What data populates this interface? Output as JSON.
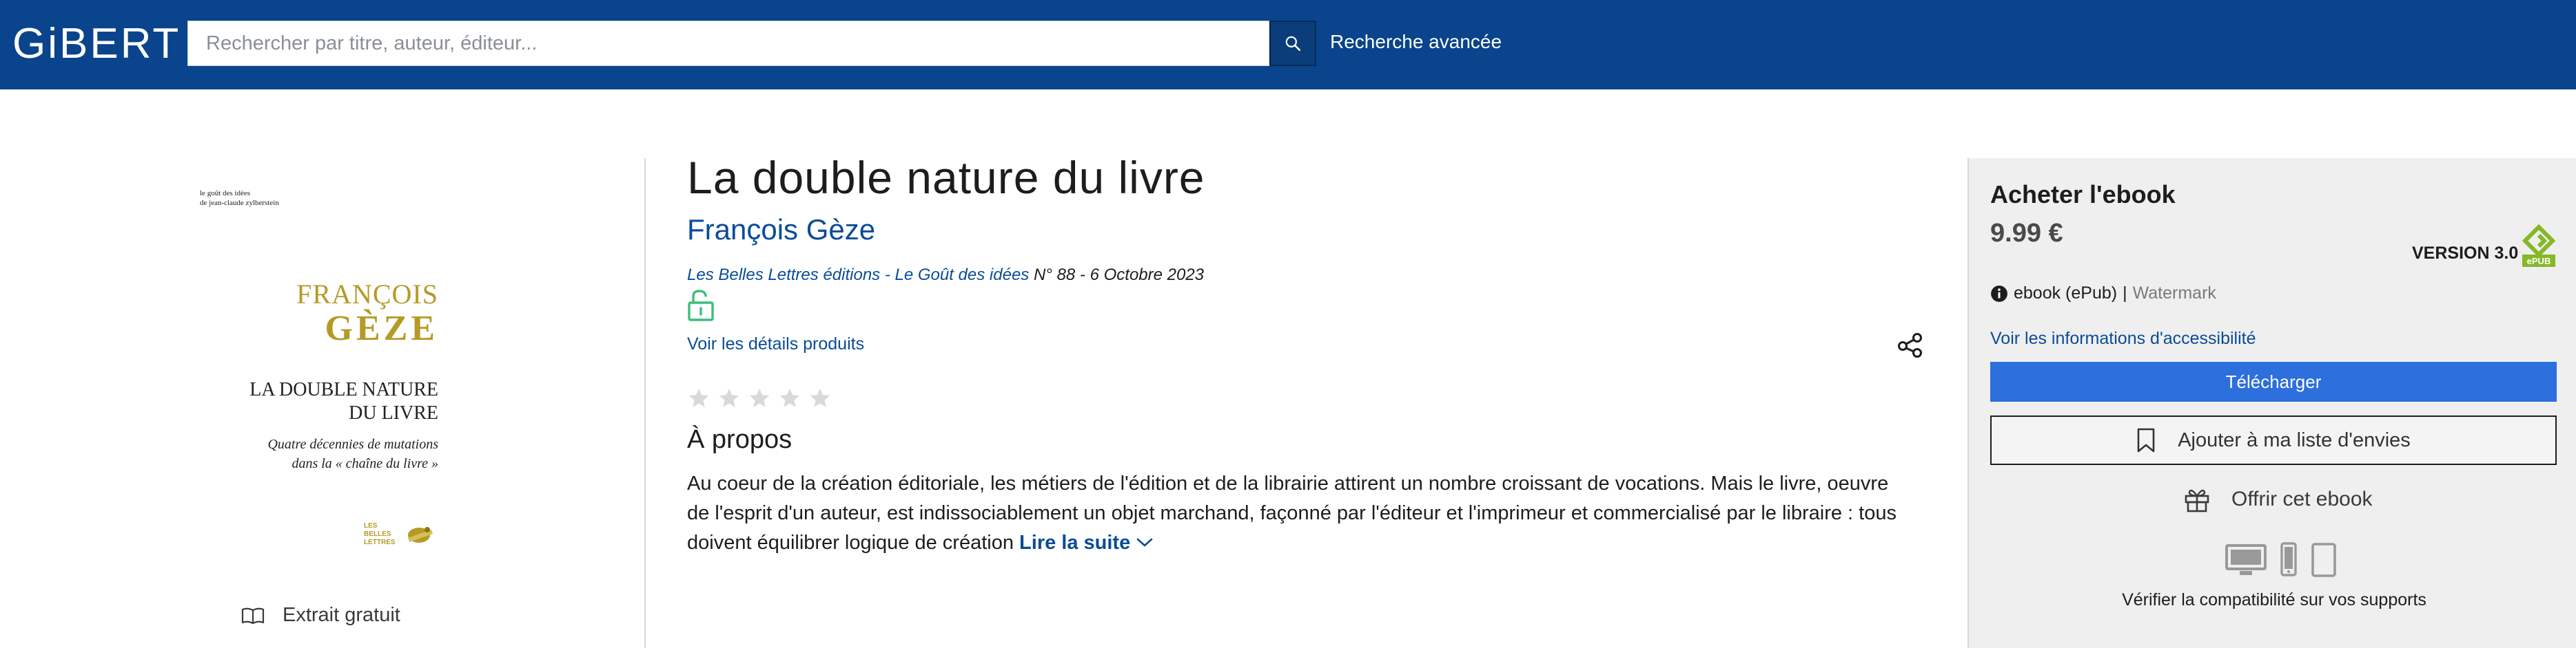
{
  "header": {
    "logo": "GiBERT",
    "search_placeholder": "Rechercher par titre, auteur, éditeur...",
    "advanced_search": "Recherche avancée",
    "background_color": "#09448c"
  },
  "cover": {
    "collection_line1": "le goût des idées",
    "collection_line2": "de jean-claude zylberstein",
    "author_first": "FRANÇOIS",
    "author_last": "GÈZE",
    "title_line1": "LA DOUBLE NATURE",
    "title_line2": "DU LIVRE",
    "subtitle_line1": "Quatre décennies de mutations",
    "subtitle_line2": "dans la « chaîne du livre »",
    "publisher_logo_line1": "LES",
    "publisher_logo_line2": "BELLES",
    "publisher_logo_line3": "LETTRES",
    "accent_color": "#b59a27"
  },
  "excerpt": {
    "label": "Extrait gratuit",
    "icon": "open-book-icon"
  },
  "product": {
    "title": "La double nature du livre",
    "author": "François Gèze",
    "publisher_link": "Les Belles Lettres éditions - Le Goût des idées",
    "publisher_rest": " N° 88 - 6 Octobre 2023",
    "details_link": "Voir les détails produits",
    "rating_stars": 0,
    "about_title": "À propos",
    "about_text": "Au coeur de la création éditoriale, les métiers de l'édition et de la librairie attirent un nombre croissant de vocations. Mais le livre, oeuvre de l'esprit d'un auteur, est indissociablement un objet marchand, façonné par l'éditeur et l'imprimeur et commercialisé par le libraire : tous doivent équilibrer logique de création",
    "read_more": "Lire la suite"
  },
  "buy_panel": {
    "title": "Acheter l'ebook",
    "price": "9.99 €",
    "version": "VERSION 3.0",
    "epub_badge": "ePUB",
    "format": "ebook (ePub)",
    "separator": "|",
    "drm": "Watermark",
    "accessibility_link": "Voir les informations d'accessibilité",
    "download_button": "Télécharger",
    "wishlist_button": "Ajouter à ma liste d'envies",
    "gift_label": "Offrir cet ebook",
    "compatibility": "Vérifier la compatibilité sur vos supports",
    "download_color": "#2c6fdd",
    "epub_color": "#86b828"
  }
}
